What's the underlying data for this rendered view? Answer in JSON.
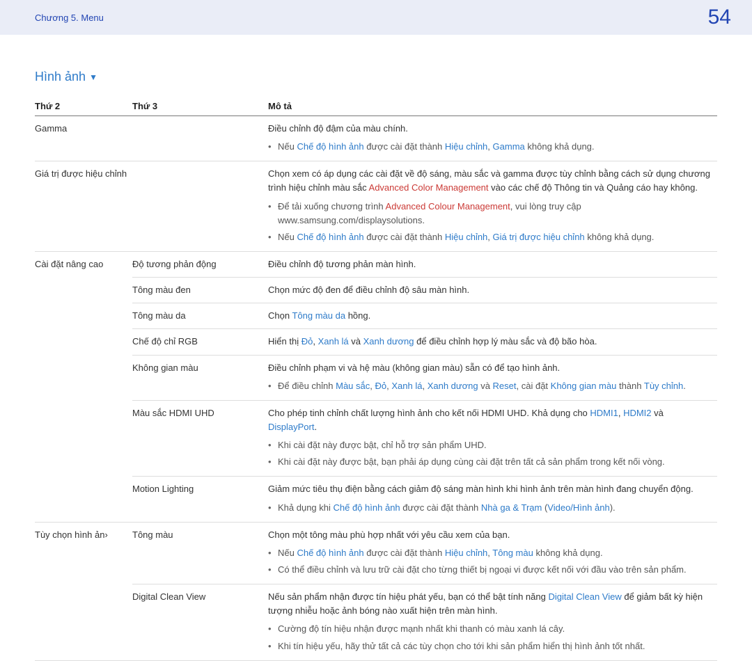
{
  "header": {
    "chapter": "Chương 5. Menu",
    "page": "54"
  },
  "section_title": "Hình ảnh",
  "columns": {
    "c1": "Thứ 2",
    "c2": "Thứ 3",
    "c3": "Mô tả"
  },
  "rows": {
    "gamma": {
      "label": "Gamma",
      "desc": "Điều chỉnh độ đậm của màu chính.",
      "bul1_a": "Nếu ",
      "bul1_picmode": "Chế độ hình ảnh",
      "bul1_b": " được cài đặt thành ",
      "bul1_calib": "Hiệu chỉnh",
      "bul1_c": ", ",
      "bul1_gamma": "Gamma",
      "bul1_d": " không khả dụng."
    },
    "calval": {
      "label": "Giá trị được hiệu chỉnh",
      "p1_a": "Chọn xem có áp dụng các cài đặt về độ sáng, màu sắc và gamma được tùy chỉnh bằng cách sử dụng chương trình hiệu chỉnh màu sắc ",
      "p1_acm": "Advanced Color Management",
      "p1_b": " vào các chế độ Thông tin và Quảng cáo hay không.",
      "bul1_a": "Để tải xuống chương trình ",
      "bul1_acm": "Advanced Colour Management",
      "bul1_b": ", vui lòng truy cập www.samsung.com/displaysolutions.",
      "bul2_a": "Nếu ",
      "bul2_picmode": "Chế độ hình ảnh",
      "bul2_b": " được cài đặt thành ",
      "bul2_calib": "Hiệu chỉnh",
      "bul2_c": ", ",
      "bul2_calval": "Giá trị được hiệu chỉnh",
      "bul2_d": " không khả dụng."
    },
    "adv": {
      "label": "Cài đặt nâng cao",
      "r1": {
        "sub": "Độ tương phản động",
        "desc": "Điều chỉnh độ tương phản màn hình."
      },
      "r2": {
        "sub": "Tông màu đen",
        "desc": "Chọn mức độ đen để điều chỉnh độ sâu màn hình."
      },
      "r3": {
        "sub": "Tông màu da",
        "desc_a": "Chọn ",
        "desc_flesh": "Tông màu da",
        "desc_b": " hồng."
      },
      "r4": {
        "sub": "Chế độ chỉ RGB",
        "a": "Hiển thị ",
        "red": "Đỏ",
        "comma1": ", ",
        "green": "Xanh lá",
        "and": " và ",
        "blue": "Xanh dương",
        "b": " để điều chỉnh hợp lý màu sắc và độ bão hòa."
      },
      "r5": {
        "sub": "Không gian màu",
        "desc": "Điều chỉnh phạm vi và hệ màu (không gian màu) sẵn có để tạo hình ảnh.",
        "bul_a": "Để điều chỉnh ",
        "bul_ms": "Màu sắc",
        "c1": ", ",
        "bul_do": "Đỏ",
        "c2": ", ",
        "bul_xl": "Xanh lá",
        "c3": ", ",
        "bul_xd": "Xanh dương",
        "and": " và ",
        "bul_reset": "Reset",
        "set": ", cài đặt ",
        "bul_kgm": "Không gian màu",
        "to": " thành ",
        "bul_tc": "Tùy chỉnh",
        "dot": "."
      },
      "r6": {
        "sub": "Màu sắc HDMI UHD",
        "a": "Cho phép tinh chỉnh chất lượng hình ảnh cho kết nối HDMI UHD. Khả dụng cho ",
        "h1": "HDMI1",
        "c1": ", ",
        "h2": "HDMI2",
        "and": " và ",
        "dp": "DisplayPort",
        "dot": ".",
        "bul1": "Khi cài đặt này được bật, chỉ hỗ trợ sản phẩm UHD.",
        "bul2": "Khi cài đặt này được bật, bạn phải áp dụng cùng cài đặt trên tất cả sản phẩm trong kết nối vòng."
      },
      "r7": {
        "sub": "Motion Lighting",
        "desc": "Giảm mức tiêu thụ điện bằng cách giảm độ sáng màn hình khi hình ảnh trên màn hình đang chuyển động.",
        "bul_a": "Khả dụng khi ",
        "bul_picmode": "Chế độ hình ảnh",
        "bul_b": " được cài đặt thành ",
        "bul_station": "Nhà ga & Trạm",
        "bul_paren_o": " (",
        "bul_vid": "Video/Hình ảnh",
        "bul_paren_c": ")."
      }
    },
    "picopt": {
      "label": "Tùy chọn hình ản›",
      "r1": {
        "sub": "Tông màu",
        "desc": "Chọn một tông màu phù hợp nhất với yêu cầu xem của bạn.",
        "bul1_a": "Nếu ",
        "bul1_picmode": "Chế độ hình ảnh",
        "bul1_b": " được cài đặt thành ",
        "bul1_calib": "Hiệu chỉnh",
        "bul1_c": ", ",
        "bul1_tm": "Tông màu",
        "bul1_d": " không khả dụng.",
        "bul2": "Có thể điều chỉnh và lưu trữ cài đặt cho từng thiết bị ngoại vi được kết nối với đầu vào trên sản phẩm."
      },
      "r2": {
        "sub": "Digital Clean View",
        "a": "Nếu sản phẩm nhận được tín hiệu phát yếu, bạn có thể bật tính năng ",
        "dcv": "Digital Clean View",
        "b": " để giảm bất kỳ hiện tượng nhiễu hoặc ảnh bóng nào xuất hiện trên màn hình.",
        "bul1": "Cường độ tín hiệu nhận được mạnh nhất khi thanh có màu xanh lá cây.",
        "bul2": "Khi tín hiệu yếu, hãy thử tất cả các tùy chọn cho tới khi sản phẩm hiển thị hình ảnh tốt nhất."
      }
    }
  }
}
